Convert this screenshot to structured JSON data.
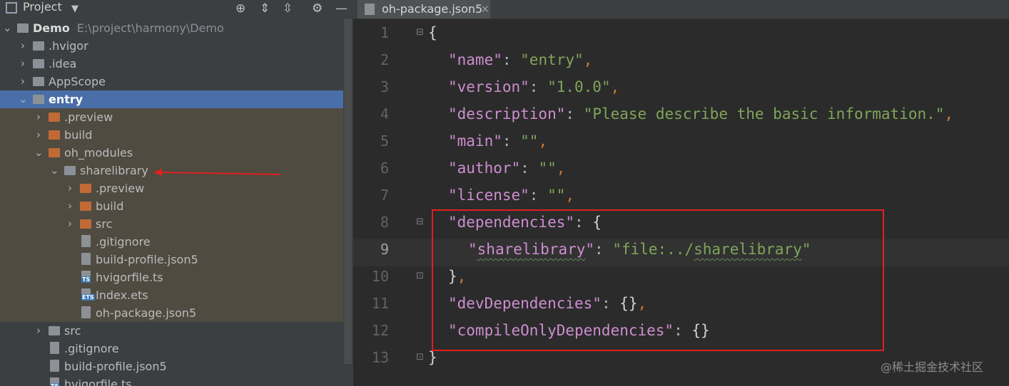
{
  "project_panel": {
    "title": "Project",
    "dropdown": "▼"
  },
  "tree": [
    {
      "label": "Demo",
      "path": "E:\\project\\harmony\\Demo",
      "arrow": "⌄",
      "icon": "folder-module-icon"
    },
    {
      "label": ".hvigor",
      "arrow": "›",
      "icon": "folder-icon"
    },
    {
      "label": ".idea",
      "arrow": "›",
      "icon": "folder-icon"
    },
    {
      "label": "AppScope",
      "arrow": "›",
      "icon": "folder-icon"
    },
    {
      "label": "entry",
      "arrow": "⌄",
      "icon": "folder-module-icon",
      "selected": true
    },
    {
      "label": ".preview",
      "arrow": "›",
      "icon": "folder-orange-icon"
    },
    {
      "label": "build",
      "arrow": "›",
      "icon": "folder-orange-icon"
    },
    {
      "label": "oh_modules",
      "arrow": "⌄",
      "icon": "folder-orange-icon"
    },
    {
      "label": "sharelibrary",
      "arrow": "⌄",
      "icon": "folder-module-icon"
    },
    {
      "label": ".preview",
      "arrow": "›",
      "icon": "folder-orange-icon"
    },
    {
      "label": "build",
      "arrow": "›",
      "icon": "folder-orange-icon"
    },
    {
      "label": "src",
      "arrow": "›",
      "icon": "folder-orange-icon"
    },
    {
      "label": ".gitignore",
      "icon": "file-config-icon"
    },
    {
      "label": "build-profile.json5",
      "icon": "file-config-icon"
    },
    {
      "label": "hvigorfile.ts",
      "icon": "file-ts-icon",
      "badge": "TS"
    },
    {
      "label": "Index.ets",
      "icon": "file-ets-icon",
      "badge": "ETS"
    },
    {
      "label": "oh-package.json5",
      "icon": "file-config-icon"
    },
    {
      "label": "src",
      "arrow": "›",
      "icon": "folder-icon"
    },
    {
      "label": ".gitignore",
      "icon": "file-config-icon"
    },
    {
      "label": "build-profile.json5",
      "icon": "file-config-icon"
    },
    {
      "label": "hvigorfile.ts",
      "icon": "file-ts-icon",
      "badge": "TS"
    }
  ],
  "editor": {
    "tab": {
      "label": "oh-package.json5",
      "close": "×"
    },
    "line_numbers": [
      "1",
      "2",
      "3",
      "4",
      "5",
      "6",
      "7",
      "8",
      "9",
      "10",
      "11",
      "12",
      "13"
    ],
    "lines": [
      "{",
      "\"name\": \"entry\",",
      "\"version\": \"1.0.0\",",
      "\"description\": \"Please describe the basic information.\",",
      "\"main\": \"\",",
      "\"author\": \"\",",
      "\"license\": \"\",",
      "\"dependencies\": {",
      "\"sharelibrary\": \"file:../sharelibrary\"",
      "},",
      "\"devDependencies\": {},",
      "\"compileOnlyDependencies\": {}",
      "}"
    ]
  },
  "watermark": "@稀土掘金技术社区",
  "colors": {
    "selection": "#4a6ea8",
    "annotation": "#e02020",
    "key": "#cc8ecf",
    "string": "#7fa55a"
  }
}
